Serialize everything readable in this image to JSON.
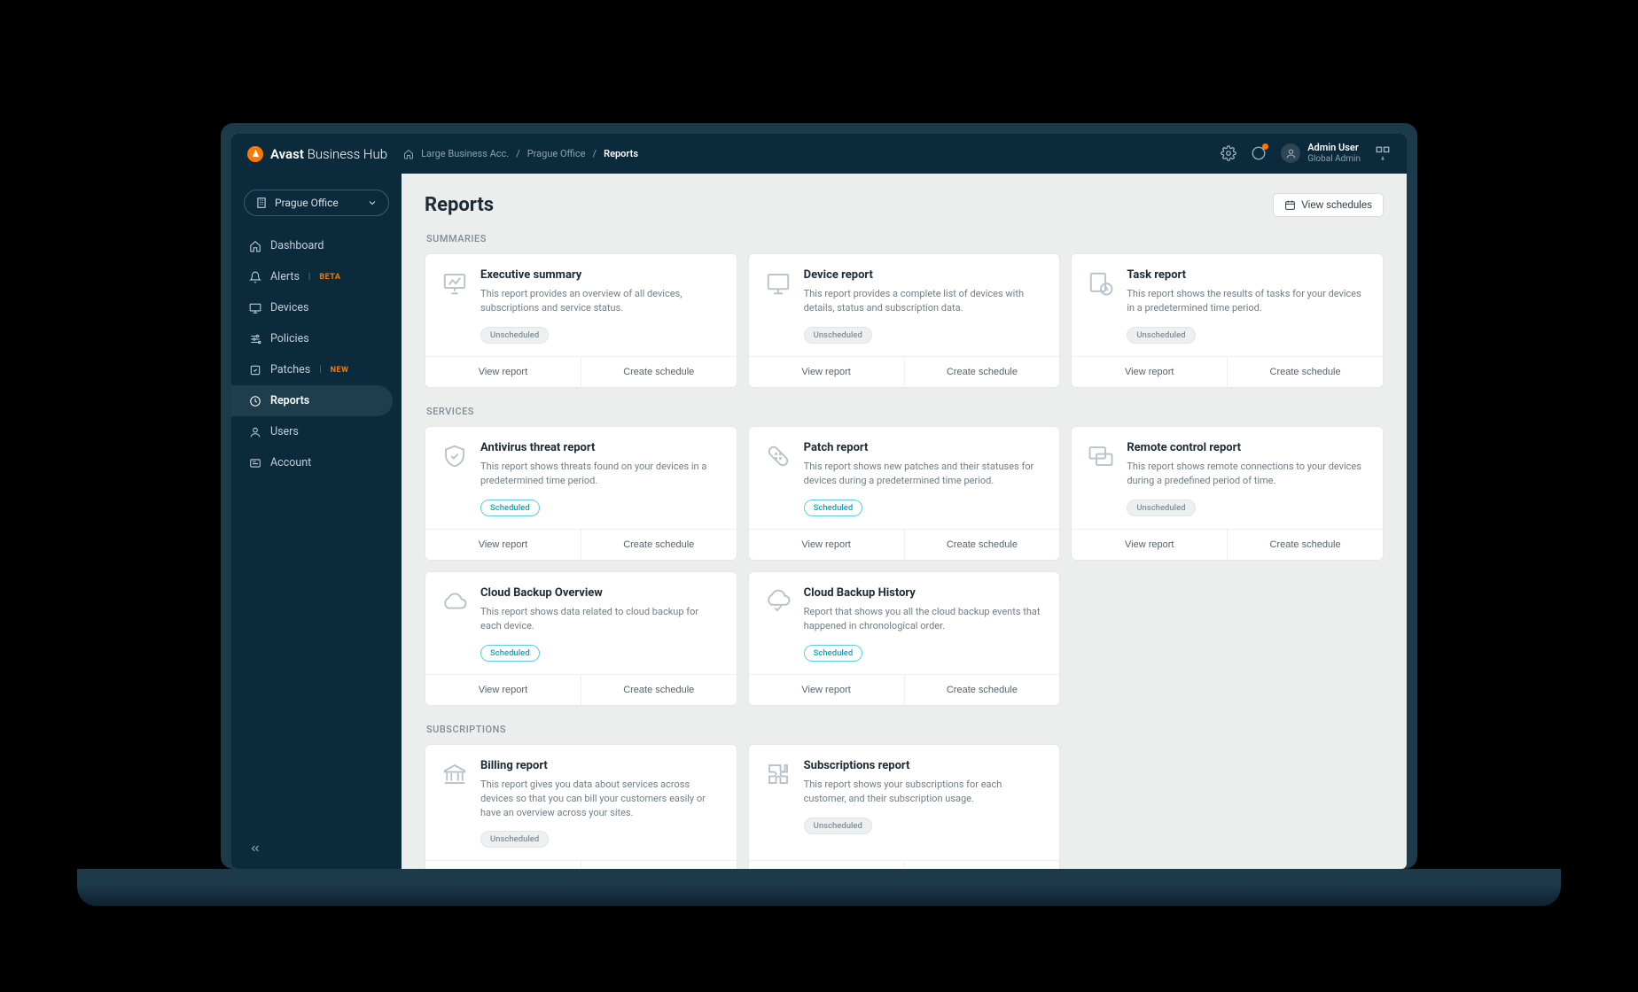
{
  "brand": {
    "name_bold": "Avast",
    "name_light": "Business Hub"
  },
  "breadcrumb": {
    "acc": "Large Business Acc.",
    "site": "Prague Office",
    "current": "Reports"
  },
  "user": {
    "name": "Admin User",
    "role": "Global Admin"
  },
  "site_selector": {
    "label": "Prague Office"
  },
  "nav": {
    "items": [
      {
        "label": "Dashboard"
      },
      {
        "label": "Alerts",
        "badge": "BETA"
      },
      {
        "label": "Devices"
      },
      {
        "label": "Policies"
      },
      {
        "label": "Patches",
        "badge": "NEW"
      },
      {
        "label": "Reports"
      },
      {
        "label": "Users"
      },
      {
        "label": "Account"
      }
    ]
  },
  "page": {
    "title": "Reports",
    "view_schedules": "View schedules"
  },
  "labels": {
    "view_report": "View report",
    "create_schedule": "Create schedule",
    "scheduled": "Scheduled",
    "unscheduled": "Unscheduled"
  },
  "sections": {
    "summaries": {
      "label": "SUMMARIES"
    },
    "services": {
      "label": "SERVICES"
    },
    "subscriptions": {
      "label": "SUBSCRIPTIONS"
    }
  },
  "cards": {
    "exec": {
      "title": "Executive summary",
      "desc": "This report provides an overview of all devices, subscriptions and service status.",
      "scheduled": false
    },
    "device": {
      "title": "Device report",
      "desc": "This report provides a complete list of devices with details, status and subscription data.",
      "scheduled": false
    },
    "task": {
      "title": "Task report",
      "desc": "This report shows the results of tasks for your devices in a predetermined time period.",
      "scheduled": false
    },
    "antivirus": {
      "title": "Antivirus threat report",
      "desc": "This report shows threats found on your devices in a predetermined time period.",
      "scheduled": true
    },
    "patch": {
      "title": "Patch report",
      "desc": "This report shows new patches and their statuses for devices during a predetermined time period.",
      "scheduled": true
    },
    "remote": {
      "title": "Remote control report",
      "desc": "This report shows remote connections to your devices during a predefined period of time.",
      "scheduled": false
    },
    "backup_ov": {
      "title": "Cloud Backup Overview",
      "desc": "This report shows data related to cloud backup for each device.",
      "scheduled": true
    },
    "backup_hist": {
      "title": "Cloud Backup History",
      "desc": "Report that shows you all the cloud backup events that happened in chronological order.",
      "scheduled": true
    },
    "billing": {
      "title": "Billing report",
      "desc": "This report gives you data about services across devices so that you can bill your customers easily or have an overview across your sites.",
      "scheduled": false
    },
    "subs": {
      "title": "Subscriptions report",
      "desc": "This report shows your subscriptions for each customer, and their subscription usage.",
      "scheduled": false
    }
  }
}
